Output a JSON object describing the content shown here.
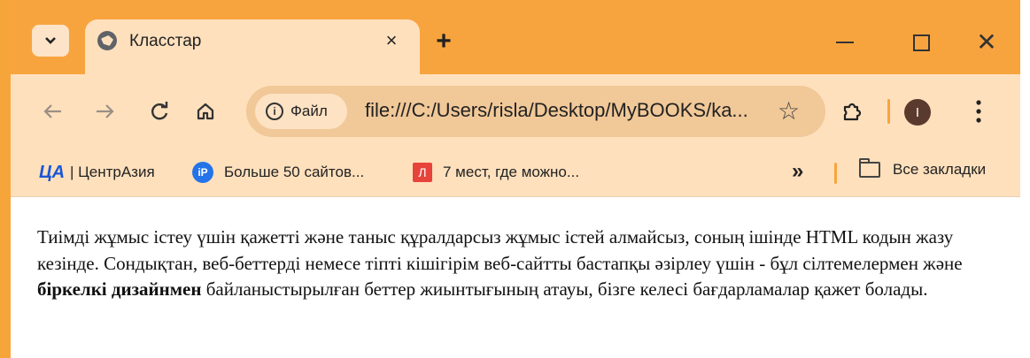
{
  "tab": {
    "title": "Класстар",
    "close_label": "×"
  },
  "new_tab_label": "+",
  "window": {
    "close_label": "✕"
  },
  "toolbar": {
    "site_chip_label": "Файл",
    "url": "file:///C:/Users/risla/Desktop/MyBOOKS/ka...",
    "avatar_letter": "I"
  },
  "bookmarks": {
    "items": [
      {
        "badge": "ЦА",
        "label": "| ЦентрАзия"
      },
      {
        "badge": "iP",
        "label": "Больше 50 сайтов..."
      },
      {
        "badge": "Л",
        "label": "7 мест, где можно..."
      }
    ],
    "more_label": "»",
    "all_label": "Все закладки"
  },
  "content": {
    "part1": "Тиімді жұмыс істеу үшін қажетті және таныс құралдарсыз жұмыс істей алмайсыз, соның ішінде HTML кодын жазу кезінде. Сондықтан, веб-беттерді немесе тіпті кішігірім веб-сайтты бастапқы әзірлеу үшін - бұл сілтемелермен және ",
    "bold": "біркелкі дизайнмен",
    "part2": " байланыстырылған беттер жиынтығының атауы, бізге келесі бағдарламалар қажет болады."
  },
  "colors": {
    "titlebar": "#f8a43e",
    "toolbar": "#ffe0bd",
    "omnibox": "#f1c898",
    "accent": "#f6a53b"
  }
}
